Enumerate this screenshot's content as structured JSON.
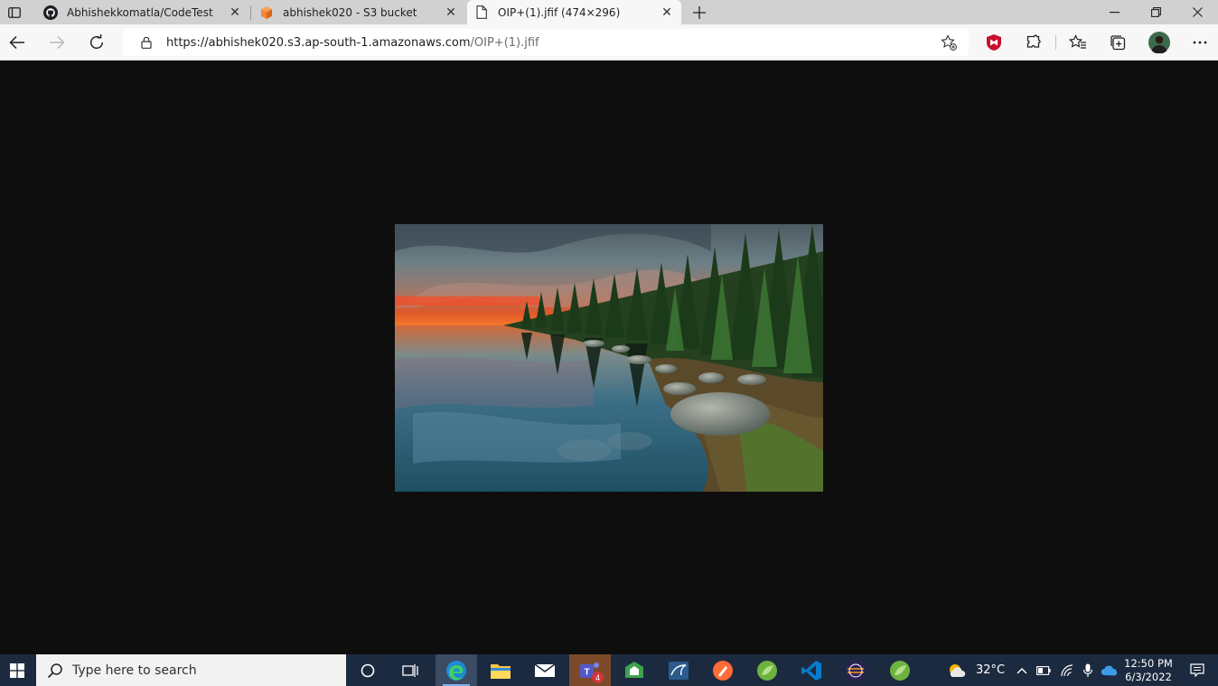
{
  "tabs": [
    {
      "title": "Abhishekkomatla/CodeTest",
      "icon": "github-icon"
    },
    {
      "title": "abhishek020 - S3 bucket",
      "icon": "aws-s3-icon"
    },
    {
      "title": "OIP+(1).jfif (474×296)",
      "icon": "document-icon",
      "active": true
    }
  ],
  "address": {
    "url_host": "https://abhishek020.s3.ap-south-1.amazonaws.com",
    "url_path": "/OIP+(1).jfif"
  },
  "toolbar_icons": [
    "add-favorite-icon",
    "mcafee-icon",
    "extensions-icon",
    "favorites-icon",
    "collections-icon",
    "profile-avatar",
    "more-icon"
  ],
  "image": {
    "width": 474,
    "height": 296
  },
  "taskbar": {
    "search_placeholder": "Type here to search",
    "teams_badge": "4",
    "weather_temp": "32°C",
    "time": "12:50 PM",
    "date": "6/3/2022"
  },
  "colors": {
    "taskbar_bg": "#1c2a3f",
    "accent": "#7fb2e8",
    "mcafee_red": "#c8102e"
  }
}
